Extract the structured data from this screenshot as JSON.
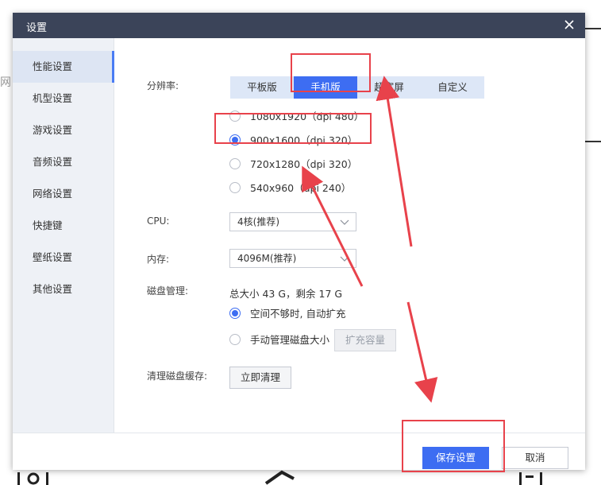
{
  "background": {
    "fragment_left": "网"
  },
  "dialog": {
    "title": "设置",
    "close_icon": "close-icon"
  },
  "sidebar": {
    "items": [
      {
        "label": "性能设置",
        "active": true
      },
      {
        "label": "机型设置"
      },
      {
        "label": "游戏设置"
      },
      {
        "label": "音频设置"
      },
      {
        "label": "网络设置"
      },
      {
        "label": "快捷键"
      },
      {
        "label": "壁纸设置"
      },
      {
        "label": "其他设置"
      }
    ]
  },
  "resolution": {
    "label": "分辨率:",
    "tabs": [
      {
        "label": "平板版"
      },
      {
        "label": "手机版",
        "active": true
      },
      {
        "label": "超宽屏"
      },
      {
        "label": "自定义"
      }
    ],
    "options": [
      {
        "label": "1080x1920（dpi 480）"
      },
      {
        "label": "900x1600（dpi 320）",
        "checked": true
      },
      {
        "label": "720x1280（dpi 320）"
      },
      {
        "label": "540x960（dpi 240）"
      }
    ]
  },
  "cpu": {
    "label": "CPU:",
    "value": "4核(推荐)"
  },
  "memory": {
    "label": "内存:",
    "value": "4096M(推荐)"
  },
  "disk": {
    "label": "磁盘管理:",
    "summary": "总大小 43 G，剩余 17 G",
    "option_auto": "空间不够时, 自动扩充",
    "option_manual": "手动管理磁盘大小",
    "expand_button": "扩充容量"
  },
  "cache": {
    "label": "清理磁盘缓存:",
    "clean_button": "立即清理"
  },
  "footer": {
    "save_button": "保存设置",
    "cancel_button": "取消"
  },
  "colors": {
    "accent": "#3d6df2",
    "titlebar": "#3b4459",
    "annotation": "#e8424b"
  }
}
